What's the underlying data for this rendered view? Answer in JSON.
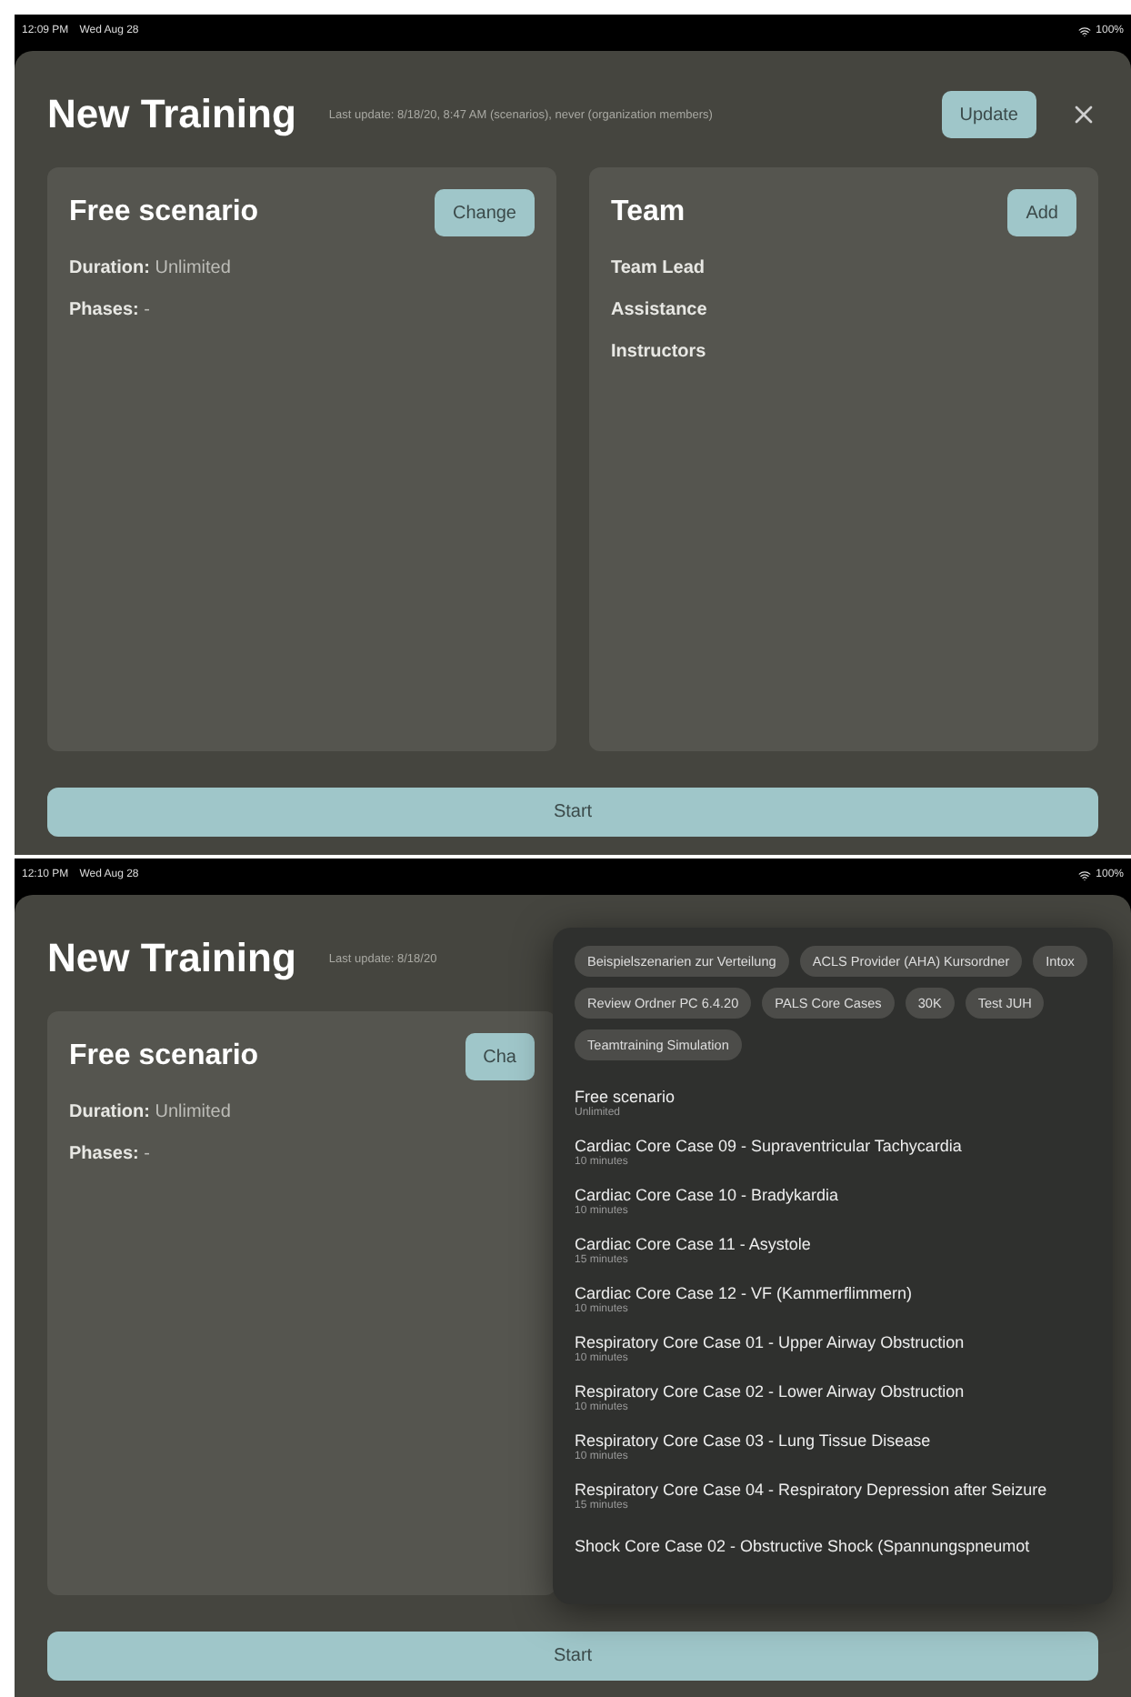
{
  "screens": [
    {
      "status_bar": {
        "time": "12:09 PM",
        "date": "Wed Aug 28",
        "battery": "100%"
      },
      "title": "New Training",
      "last_update": "Last update: 8/18/20, 8:47 AM (scenarios), never (organization members)",
      "update_button": "Update",
      "scenario_panel": {
        "title": "Free scenario",
        "change_button": "Change",
        "details": [
          "**Duration:** Unlimited",
          "**Phases:** -"
        ]
      },
      "team_panel": {
        "title": "Team",
        "add_button": "Add",
        "roles": [
          "Team Lead",
          "Assistance",
          "Instructors"
        ]
      },
      "start_button": "Start"
    },
    {
      "status_bar": {
        "time": "12:10 PM",
        "date": "Wed Aug 28",
        "battery": "100%"
      },
      "title": "New Training",
      "last_update": "Last update: 8/18/20",
      "scenario_panel": {
        "title": "Free scenario",
        "change_button": "Cha",
        "details": [
          "**Duration:** Unlimited",
          "**Phases:** -"
        ]
      },
      "picker": {
        "tags": [
          "Beispielszenarien zur Verteilung",
          "ACLS Provider (AHA) Kursordner",
          "Intox",
          "Review Ordner PC 6.4.20",
          "PALS Core Cases",
          "30K",
          "Test JUH",
          "Teamtraining Simulation"
        ],
        "scenarios": [
          {
            "name": "Free scenario",
            "duration": "Unlimited"
          },
          {
            "name": "Cardiac Core Case 09 - Supraventricular Tachycardia",
            "duration": "10 minutes"
          },
          {
            "name": "Cardiac Core Case 10 - Bradykardia",
            "duration": "10 minutes"
          },
          {
            "name": "Cardiac Core Case 11 - Asystole",
            "duration": "15 minutes"
          },
          {
            "name": "Cardiac Core Case 12 - VF (Kammerflimmern)",
            "duration": "10 minutes"
          },
          {
            "name": "Respiratory Core Case 01 - Upper Airway Obstruction",
            "duration": "10 minutes"
          },
          {
            "name": "Respiratory Core Case 02 - Lower Airway Obstruction",
            "duration": "10 minutes"
          },
          {
            "name": "Respiratory Core Case 03 - Lung Tissue Disease",
            "duration": "10 minutes"
          },
          {
            "name": "Respiratory Core Case 04 - Respiratory Depression after Seizure",
            "duration": "15 minutes"
          },
          {
            "name": "Shock Core Case 02 - Obstructive Shock (Spannungspneumot"
          }
        ]
      },
      "start_button": "Start"
    }
  ]
}
